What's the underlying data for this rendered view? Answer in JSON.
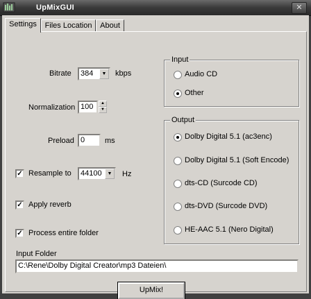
{
  "window": {
    "title": "UpMixGUI",
    "close_symbol": "✕"
  },
  "tabs": [
    {
      "label": "Settings"
    },
    {
      "label": "Files Location"
    },
    {
      "label": "About"
    }
  ],
  "settings": {
    "bitrate": {
      "label": "Bitrate",
      "value": "384",
      "unit": "kbps"
    },
    "normalization": {
      "label": "Normalization",
      "value": "100"
    },
    "preload": {
      "label": "Preload",
      "value": "0",
      "unit": "ms"
    },
    "resample": {
      "label": "Resample to",
      "value": "44100",
      "unit": "Hz",
      "checked": true
    },
    "apply_reverb": {
      "label": "Apply reverb",
      "checked": true
    },
    "process_folder": {
      "label": "Process entire folder",
      "checked": true
    }
  },
  "input_group": {
    "title": "Input",
    "options": [
      {
        "label": "Audio CD",
        "selected": false
      },
      {
        "label": "Other",
        "selected": true
      }
    ]
  },
  "output_group": {
    "title": "Output",
    "options": [
      {
        "label": "Dolby Digital 5.1 (ac3enc)",
        "selected": true
      },
      {
        "label": "Dolby Digital 5.1 (Soft Encode)",
        "selected": false
      },
      {
        "label": "dts-CD (Surcode CD)",
        "selected": false
      },
      {
        "label": "dts-DVD (Surcode DVD)",
        "selected": false
      },
      {
        "label": "HE-AAC 5.1 (Nero Digital)",
        "selected": false
      }
    ]
  },
  "input_folder": {
    "label": "Input Folder",
    "value": "C:\\Rene\\Dolby Digital Creator\\mp3 Dateien\\"
  },
  "upmix_button": {
    "label": "UpMix!"
  },
  "check_mark": "✓",
  "colors": {
    "face": "#d6d3ce",
    "titlebar": "#3a3a3a"
  }
}
